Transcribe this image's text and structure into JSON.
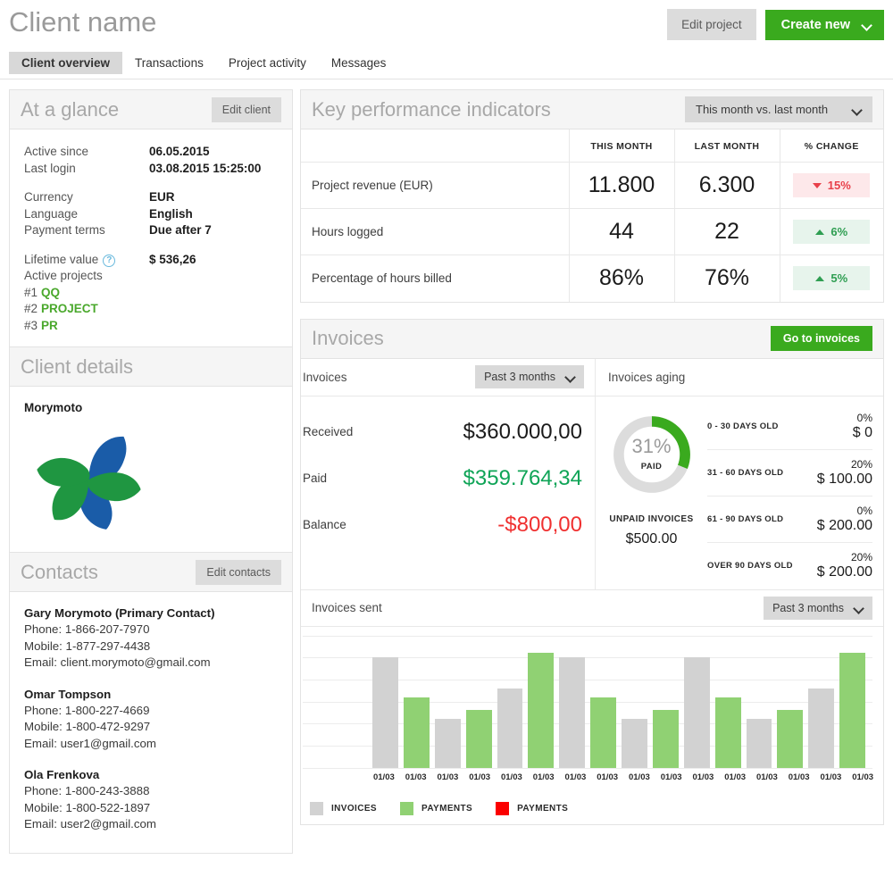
{
  "header": {
    "title": "Client name",
    "edit_project_label": "Edit project",
    "create_new_label": "Create new"
  },
  "tabs": [
    {
      "label": "Client overview",
      "active": true
    },
    {
      "label": "Transactions",
      "active": false
    },
    {
      "label": "Project activity",
      "active": false
    },
    {
      "label": "Messages",
      "active": false
    }
  ],
  "at_a_glance": {
    "title": "At a glance",
    "edit_button": "Edit client",
    "group1": [
      {
        "key": "Active since",
        "value": "06.05.2015"
      },
      {
        "key": "Last login",
        "value": "03.08.2015 15:25:00"
      }
    ],
    "group2": [
      {
        "key": "Currency",
        "value": "EUR"
      },
      {
        "key": "Language",
        "value": "English"
      },
      {
        "key": "Payment terms",
        "value": "Due after 7"
      }
    ],
    "lifetime_label": "Lifetime value",
    "lifetime_help": "?",
    "lifetime_value": "$ 536,26",
    "active_projects_label": "Active projects",
    "projects": [
      {
        "index": "#1",
        "name": "QQ"
      },
      {
        "index": "#2",
        "name": "PROJECT"
      },
      {
        "index": "#3",
        "name": "PR"
      }
    ]
  },
  "client_details": {
    "title": "Client details",
    "company": "Morymoto",
    "logo_colors": {
      "blue": "#1a5ca8",
      "green": "#1f9641"
    }
  },
  "contacts": {
    "title": "Contacts",
    "edit_button": "Edit contacts",
    "people": [
      {
        "name": "Gary Morymoto (Primary Contact)",
        "phone": "Phone: 1-866-207-7970",
        "mobile": "Mobile: 1-877-297-4438",
        "email": "Email: client.morymoto@gmail.com"
      },
      {
        "name": "Omar Tompson",
        "phone": "Phone: 1-800-227-4669",
        "mobile": "Mobile: 1-800-472-9297",
        "email": "Email: user1@gmail.com"
      },
      {
        "name": "Ola Frenkova",
        "phone": "Phone: 1-800-243-3888",
        "mobile": "Mobile: 1-800-522-1897",
        "email": "Email: user2@gmail.com"
      }
    ]
  },
  "kpi": {
    "title": "Key performance indicators",
    "period_select": "This month vs. last month",
    "columns": [
      "",
      "THIS MONTH",
      "LAST MONTH",
      "% CHANGE"
    ],
    "rows": [
      {
        "label": "Project revenue (EUR)",
        "this_month": "11.800",
        "last_month": "6.300",
        "change": "15%",
        "direction": "down"
      },
      {
        "label": "Hours logged",
        "this_month": "44",
        "last_month": "22",
        "change": "6%",
        "direction": "up"
      },
      {
        "label": "Percentage of hours billed",
        "this_month": "86%",
        "last_month": "76%",
        "change": "5%",
        "direction": "up"
      }
    ]
  },
  "invoices": {
    "title": "Invoices",
    "go_to_invoices": "Go to invoices",
    "left_label": "Invoices",
    "left_select": "Past 3 months",
    "rows": [
      {
        "key": "Received",
        "value": "$360.000,00",
        "tone": "black"
      },
      {
        "key": "Paid",
        "value": "$359.764,34",
        "tone": "green"
      },
      {
        "key": "Balance",
        "value": "-$800,00",
        "tone": "red"
      }
    ],
    "aging_label": "Invoices aging",
    "donut": {
      "percent": "31%",
      "percent_value": 31,
      "sub_label": "PAID"
    },
    "unpaid_label": "UNPAID INVOICES",
    "unpaid_value": "$500.00",
    "aging_rows": [
      {
        "label": "0 - 30 DAYS OLD",
        "percent": "0%",
        "amount": "$ 0"
      },
      {
        "label": "31 - 60 DAYS OLD",
        "percent": "20%",
        "amount": "$ 100.00"
      },
      {
        "label": "61 - 90 DAYS OLD",
        "percent": "0%",
        "amount": "$ 200.00"
      },
      {
        "label": "OVER 90 DAYS OLD",
        "percent": "20%",
        "amount": "$ 200.00"
      }
    ]
  },
  "invoices_sent": {
    "title": "Invoices sent",
    "period_select": "Past 3 months",
    "legend": [
      {
        "label": "INVOICES",
        "color": "#d2d2d2"
      },
      {
        "label": "PAYMENTS",
        "color": "#90d173"
      },
      {
        "label": "PAYMENTS",
        "color": "#fb0000"
      }
    ]
  },
  "chart_data": {
    "type": "bar",
    "title": "Invoices sent",
    "xlabel": "",
    "ylabel": "",
    "grid": true,
    "legend_position": "bottom-left",
    "categories": [
      "01/03",
      "01/03",
      "01/03",
      "01/03",
      "01/03",
      "01/03",
      "01/03",
      "01/03",
      "01/03",
      "01/03",
      "01/03",
      "01/03",
      "01/03",
      "01/03",
      "01/03",
      "01/03"
    ],
    "series": [
      {
        "name": "INVOICES",
        "color": "#d2d2d2",
        "values": [
          100,
          null,
          44,
          null,
          72,
          null,
          100,
          null,
          44,
          null,
          100,
          null,
          44,
          null,
          72,
          null
        ]
      },
      {
        "name": "PAYMENTS",
        "color": "#90d173",
        "values": [
          null,
          64,
          null,
          52,
          null,
          104,
          null,
          64,
          null,
          52,
          null,
          64,
          null,
          52,
          null,
          104
        ]
      },
      {
        "name": "PAYMENTS",
        "color": "#fb0000",
        "values": [
          null,
          null,
          null,
          null,
          null,
          null,
          null,
          null,
          null,
          null,
          null,
          null,
          null,
          null,
          null,
          null
        ]
      }
    ],
    "bars": [
      {
        "label": "01/03",
        "series": "INVOICES",
        "value": 100
      },
      {
        "label": "01/03",
        "series": "PAYMENTS",
        "value": 64
      },
      {
        "label": "01/03",
        "series": "INVOICES",
        "value": 44
      },
      {
        "label": "01/03",
        "series": "PAYMENTS",
        "value": 52
      },
      {
        "label": "01/03",
        "series": "INVOICES",
        "value": 72
      },
      {
        "label": "01/03",
        "series": "PAYMENTS",
        "value": 104
      },
      {
        "label": "01/03",
        "series": "INVOICES",
        "value": 100
      },
      {
        "label": "01/03",
        "series": "PAYMENTS",
        "value": 64
      },
      {
        "label": "01/03",
        "series": "INVOICES",
        "value": 44
      },
      {
        "label": "01/03",
        "series": "PAYMENTS",
        "value": 52
      },
      {
        "label": "01/03",
        "series": "INVOICES",
        "value": 100
      },
      {
        "label": "01/03",
        "series": "PAYMENTS",
        "value": 64
      },
      {
        "label": "01/03",
        "series": "INVOICES",
        "value": 44
      },
      {
        "label": "01/03",
        "series": "PAYMENTS",
        "value": 52
      },
      {
        "label": "01/03",
        "series": "INVOICES",
        "value": 72
      },
      {
        "label": "01/03",
        "series": "PAYMENTS",
        "value": 104
      }
    ],
    "ylim": [
      0,
      120
    ],
    "gridline_count": 7
  },
  "theme": {
    "green": "#3aaa1e",
    "bar_green": "#90d173",
    "bar_grey": "#d2d2d2",
    "red": "#f03030",
    "title_grey": "#a8a8a8"
  }
}
